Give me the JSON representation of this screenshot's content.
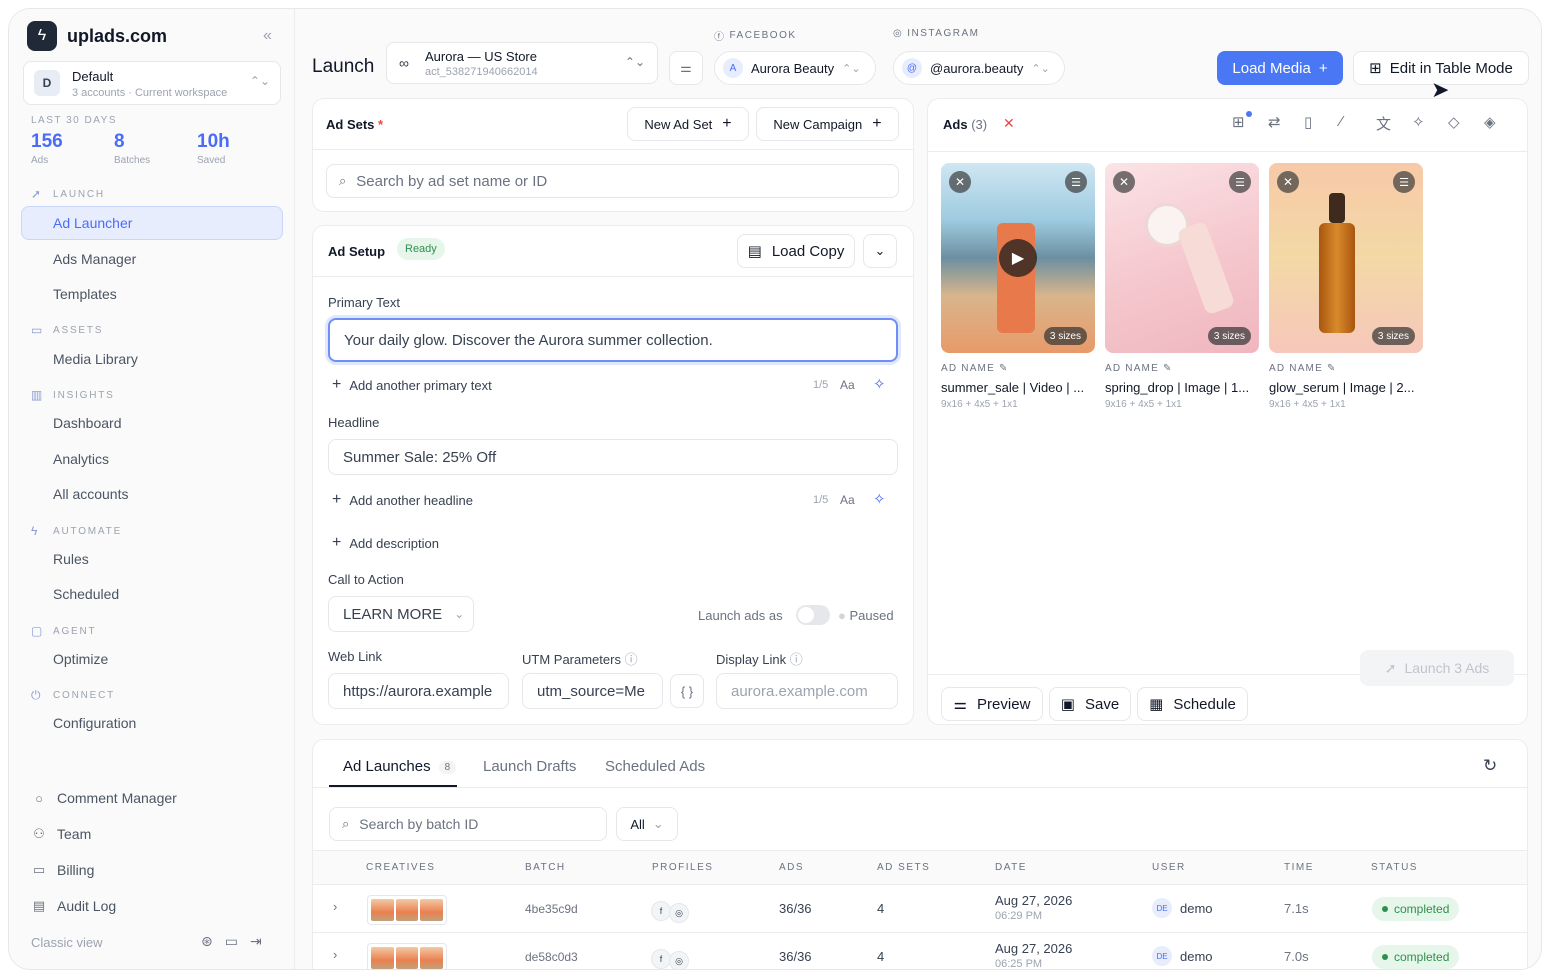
{
  "brand": {
    "name": "uplads.com",
    "logo_icon": "bolt-icon"
  },
  "workspace": {
    "initial": "D",
    "name": "Default",
    "sub": "3 accounts · Current workspace"
  },
  "stats": {
    "label": "LAST 30 DAYS",
    "items": [
      {
        "value": "156",
        "label": "Ads"
      },
      {
        "value": "8",
        "label": "Batches"
      },
      {
        "value": "10h",
        "label": "Saved"
      }
    ]
  },
  "nav": {
    "launch": {
      "title": "LAUNCH",
      "items": [
        "Ad Launcher",
        "Ads Manager",
        "Templates"
      ]
    },
    "assets": {
      "title": "ASSETS",
      "items": [
        "Media Library"
      ]
    },
    "insights": {
      "title": "INSIGHTS",
      "items": [
        "Dashboard",
        "Analytics",
        "All accounts"
      ]
    },
    "automate": {
      "title": "AUTOMATE",
      "items": [
        "Rules",
        "Scheduled"
      ]
    },
    "agent": {
      "title": "AGENT",
      "items": [
        "Optimize"
      ]
    },
    "connect": {
      "title": "CONNECT",
      "items": [
        "Configuration"
      ]
    }
  },
  "footer_nav": [
    "Comment Manager",
    "Team",
    "Billing",
    "Audit Log"
  ],
  "classic_view": "Classic view",
  "header": {
    "title": "Launch",
    "account": {
      "name": "Aurora — US Store",
      "id": "act_538271940662014"
    },
    "facebook": {
      "label": "FACEBOOK",
      "initial": "A",
      "page": "Aurora Beauty"
    },
    "instagram": {
      "label": "INSTAGRAM",
      "initial": "@",
      "handle": "@aurora.beauty"
    },
    "load_media": "Load Media",
    "edit_table": "Edit in Table Mode"
  },
  "ad_sets": {
    "title": "Ad Sets",
    "required": "*",
    "new_ad_set": "New Ad Set",
    "new_campaign": "New Campaign",
    "search_placeholder": "Search by ad set name or ID"
  },
  "ad_setup": {
    "title": "Ad Setup",
    "status": "Ready",
    "load_copy": "Load Copy",
    "primary_text_label": "Primary Text",
    "primary_text_value": "Your daily glow. Discover the Aurora summer collection.",
    "add_primary": "Add another primary text",
    "primary_counter": "1/5",
    "headline_label": "Headline",
    "headline_value": "Summer Sale: 25% Off",
    "add_headline": "Add another headline",
    "headline_counter": "1/5",
    "aa": "Aa",
    "add_description": "Add description",
    "cta_label": "Call to Action",
    "cta_value": "LEARN MORE",
    "launch_as": "Launch ads as",
    "launch_state": "Paused",
    "web_link_label": "Web Link",
    "web_link_value": "https://aurora.example",
    "utm_label": "UTM Parameters",
    "utm_value": "utm_source=Me",
    "display_link_label": "Display Link",
    "display_link_placeholder": "aurora.example.com"
  },
  "ads": {
    "title": "Ads",
    "count": "(3)",
    "meta_label": "AD NAME",
    "items": [
      {
        "name": "summer_sale | Video | ...",
        "dims": "9x16 + 4x5 + 1x1",
        "sizes": "3 sizes"
      },
      {
        "name": "spring_drop | Image | 1...",
        "dims": "9x16 + 4x5 + 1x1",
        "sizes": "3 sizes"
      },
      {
        "name": "glow_serum | Image | 2...",
        "dims": "9x16 + 4x5 + 1x1",
        "sizes": "3 sizes"
      }
    ],
    "preview": "Preview",
    "save": "Save",
    "schedule": "Schedule",
    "launch": "Launch 3 Ads"
  },
  "history": {
    "tabs": [
      "Ad Launches",
      "Launch Drafts",
      "Scheduled Ads"
    ],
    "launch_count": "8",
    "search_placeholder": "Search by batch ID",
    "filter": "All",
    "columns": [
      "CREATIVES",
      "BATCH",
      "PROFILES",
      "ADS",
      "AD SETS",
      "DATE",
      "USER",
      "TIME",
      "STATUS"
    ],
    "rows": [
      {
        "batch": "4be35c9d",
        "ads": "36/36",
        "ad_sets": "4",
        "date": "Aug 27, 2026",
        "time_of_day": "06:29 PM",
        "user_initials": "DE",
        "user": "demo",
        "time": "7.1s",
        "status": "completed"
      },
      {
        "batch": "de58c0d3",
        "ads": "36/36",
        "ad_sets": "4",
        "date": "Aug 27, 2026",
        "time_of_day": "06:25 PM",
        "user_initials": "DE",
        "user": "demo",
        "time": "7.0s",
        "status": "completed"
      }
    ]
  },
  "colors": {
    "accent": "#4a78f5",
    "success": "#2f8f4e",
    "danger": "#ef4444"
  }
}
